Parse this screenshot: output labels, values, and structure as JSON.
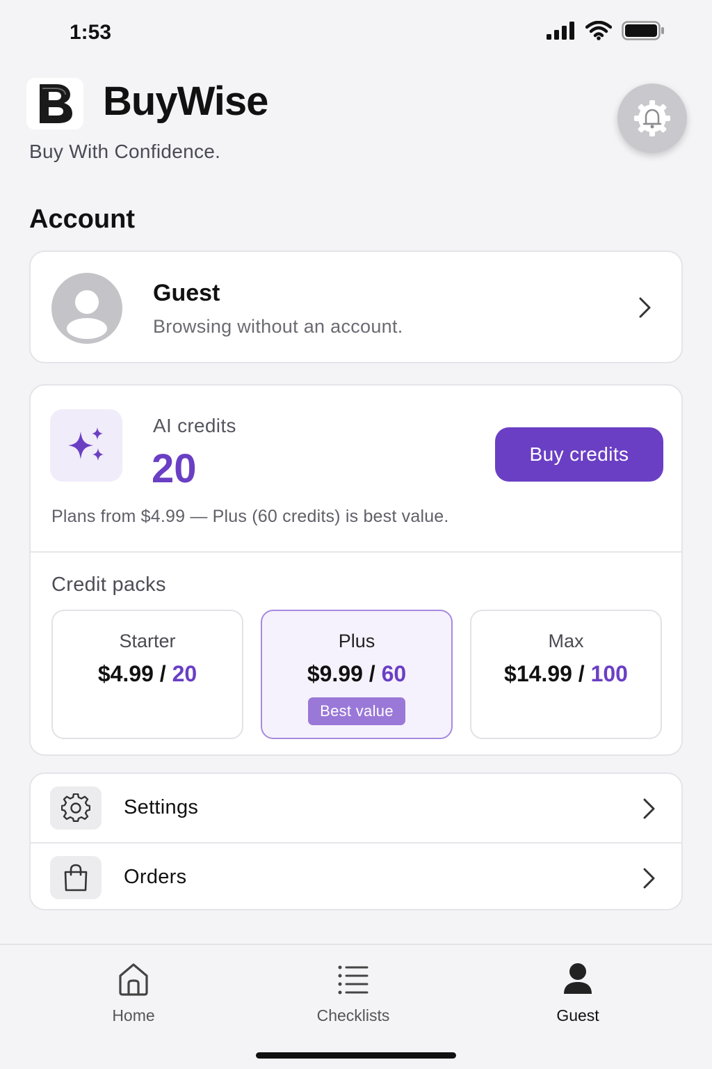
{
  "status_bar": {
    "time": "1:53",
    "icons": [
      "cellular-signal-icon",
      "wifi-icon",
      "battery-icon"
    ]
  },
  "header": {
    "logo_letter": "B",
    "title": "BuyWise",
    "tagline": "Buy With Confidence.",
    "action_icon": "bell-gear-icon"
  },
  "account": {
    "section_title": "Account",
    "profile": {
      "name": "Guest",
      "subtitle": "Browsing without an account."
    }
  },
  "credits": {
    "label": "AI credits",
    "value": "20",
    "buy_label": "Buy credits",
    "plans_note": "Plans from $4.99 — Plus (60 credits) is best value.",
    "packs_title": "Credit packs",
    "packs": [
      {
        "name": "Starter",
        "price": "$4.99 / ",
        "credits": "20"
      },
      {
        "name": "Plus",
        "price": "$9.99 / ",
        "credits": "60",
        "badge": "Best value"
      },
      {
        "name": "Max",
        "price": "$14.99 / ",
        "credits": "100"
      }
    ]
  },
  "menu": [
    {
      "label": "Settings",
      "icon": "gear-icon"
    },
    {
      "label": "Orders",
      "icon": "shopping-bag-icon"
    }
  ],
  "tabs": [
    {
      "label": "Home",
      "icon": "home-icon"
    },
    {
      "label": "Checklists",
      "icon": "list-icon"
    },
    {
      "label": "Guest",
      "icon": "person-icon",
      "active": true
    }
  ],
  "colors": {
    "accent": "#6a3fc4",
    "accent_light": "#f1ecfa",
    "background": "#f4f4f7"
  }
}
